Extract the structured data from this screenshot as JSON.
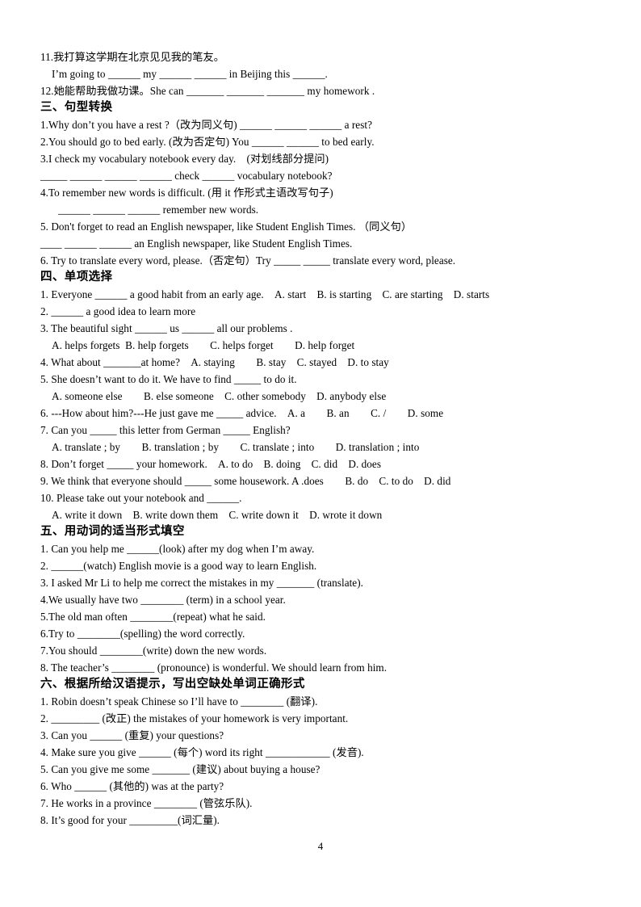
{
  "document": {
    "page_number": "4",
    "lines": [
      {
        "id": "l01",
        "style": "line",
        "text": "11.我打算这学期在北京见见我的笔友。"
      },
      {
        "id": "l02",
        "style": "indent1",
        "text": "I’m going to ______ my ______ ______ in Beijing this ______."
      },
      {
        "id": "l03",
        "style": "line",
        "text": "12.她能帮助我做功课。She can _______ _______ _______ my homework ."
      },
      {
        "id": "l04",
        "style": "heading",
        "text": "三、句型转换"
      },
      {
        "id": "l05",
        "style": "line",
        "text": "1.Why don’t you have a rest ?（改为同义句) ______ ______ ______ a rest?"
      },
      {
        "id": "l06",
        "style": "line",
        "text": "2.You should go to bed early. (改为否定句) You ______ ______ to bed early."
      },
      {
        "id": "l07",
        "style": "line",
        "text": "3.I check my vocabulary notebook every day.　(对划线部分提问)"
      },
      {
        "id": "l08",
        "style": "line",
        "text": "_____ ______ ______ ______ check ______ vocabulary notebook?"
      },
      {
        "id": "l09",
        "style": "line",
        "text": "4.To remember new words is difficult. (用 it 作形式主语改写句子)"
      },
      {
        "id": "l10",
        "style": "indent2",
        "text": "______ ______ ______ remember new words."
      },
      {
        "id": "l11",
        "style": "line",
        "text": "5. Don't forget to read an English newspaper, like Student English Times. （同义句）"
      },
      {
        "id": "l12",
        "style": "line",
        "text": "____ ______ ______ an English newspaper, like Student English Times."
      },
      {
        "id": "l13",
        "style": "line",
        "text": "6. Try to translate every word, please.（否定句）Try _____ _____ translate every word, please."
      },
      {
        "id": "l14",
        "style": "heading",
        "text": "四、单项选择"
      },
      {
        "id": "l15",
        "style": "line",
        "text": "1. Everyone ______ a good habit from an early age.　A. start　B. is starting　C. are starting　D. starts"
      },
      {
        "id": "l16",
        "style": "line",
        "text": "2. ______ a good idea to learn more"
      },
      {
        "id": "l17",
        "style": "line",
        "text": "3. The beautiful sight ______ us ______ all our problems ."
      },
      {
        "id": "l18",
        "style": "indent1",
        "text": "A. helps forgets  B. help forgets　　C. helps forget　　D. help forget"
      },
      {
        "id": "l19",
        "style": "line",
        "text": "4. What about _______at home?　A. staying　　B. stay　C. stayed　D. to stay"
      },
      {
        "id": "l20",
        "style": "line",
        "text": "5. She doesn’t want to do it. We have to find _____ to do it."
      },
      {
        "id": "l21",
        "style": "indent1",
        "text": "A. someone else　　B. else someone　C. other somebody　D. anybody else"
      },
      {
        "id": "l22",
        "style": "line",
        "text": "6. ---How about him?---He just gave me _____ advice.　A. a　　B. an　　C. /　　D. some"
      },
      {
        "id": "l23",
        "style": "line",
        "text": "7. Can you _____ this letter from German _____ English?"
      },
      {
        "id": "l24",
        "style": "indent1",
        "text": "A. translate ; by　　B. translation ; by　　C. translate ; into　　D. translation ; into"
      },
      {
        "id": "l25",
        "style": "line",
        "text": "8. Don’t forget _____ your homework.　A. to do　B. doing　C. did　D. does"
      },
      {
        "id": "l26",
        "style": "line",
        "text": "9. We think that everyone should _____ some housework. A .does　　B. do　C. to do　D. did"
      },
      {
        "id": "l27",
        "style": "line",
        "text": "10. Please take out your notebook and ______."
      },
      {
        "id": "l28",
        "style": "indent1",
        "text": "A. write it down　B. write down them　C. write down it　D. wrote it down"
      },
      {
        "id": "l29",
        "style": "heading",
        "text": "五、用动词的适当形式填空"
      },
      {
        "id": "l30",
        "style": "line",
        "text": "1. Can you help me ______(look) after my dog when I’m away."
      },
      {
        "id": "l31",
        "style": "line",
        "text": "2. ______(watch) English movie is a good way to learn English."
      },
      {
        "id": "l32",
        "style": "line",
        "text": "3. I asked Mr Li to help me correct the mistakes in my _______ (translate)."
      },
      {
        "id": "l33",
        "style": "line",
        "text": "4.We usually have two ________ (term) in a school year."
      },
      {
        "id": "l34",
        "style": "line",
        "text": "5.The old man often ________(repeat) what he said."
      },
      {
        "id": "l35",
        "style": "line",
        "text": "6.Try to ________(spelling) the word correctly."
      },
      {
        "id": "l36",
        "style": "line",
        "text": "7.You should ________(write) down the new words."
      },
      {
        "id": "l37",
        "style": "line",
        "text": "8. The teacher’s ________ (pronounce) is wonderful. We should learn from him."
      },
      {
        "id": "l38",
        "style": "heading",
        "text": "六、根据所给汉语提示，写出空缺处单词正确形式"
      },
      {
        "id": "l39",
        "style": "line",
        "text": "1. Robin doesn’t speak Chinese so I’ll have to ________ (翻译)."
      },
      {
        "id": "l40",
        "style": "line",
        "text": "2. _________ (改正) the mistakes of your homework is very important."
      },
      {
        "id": "l41",
        "style": "line",
        "text": "3. Can you ______ (重复) your questions?"
      },
      {
        "id": "l42",
        "style": "line",
        "text": "4. Make sure you give ______ (每个) word its right ____________ (发音)."
      },
      {
        "id": "l43",
        "style": "line",
        "text": "5. Can you give me some _______ (建议) about buying a house?"
      },
      {
        "id": "l44",
        "style": "line",
        "text": "6. Who ______ (其他的) was at the party?"
      },
      {
        "id": "l45",
        "style": "line",
        "text": "7. He works in a province ________ (管弦乐队)."
      },
      {
        "id": "l46",
        "style": "line",
        "text": "8. It’s good for your _________(词汇量)."
      }
    ]
  }
}
